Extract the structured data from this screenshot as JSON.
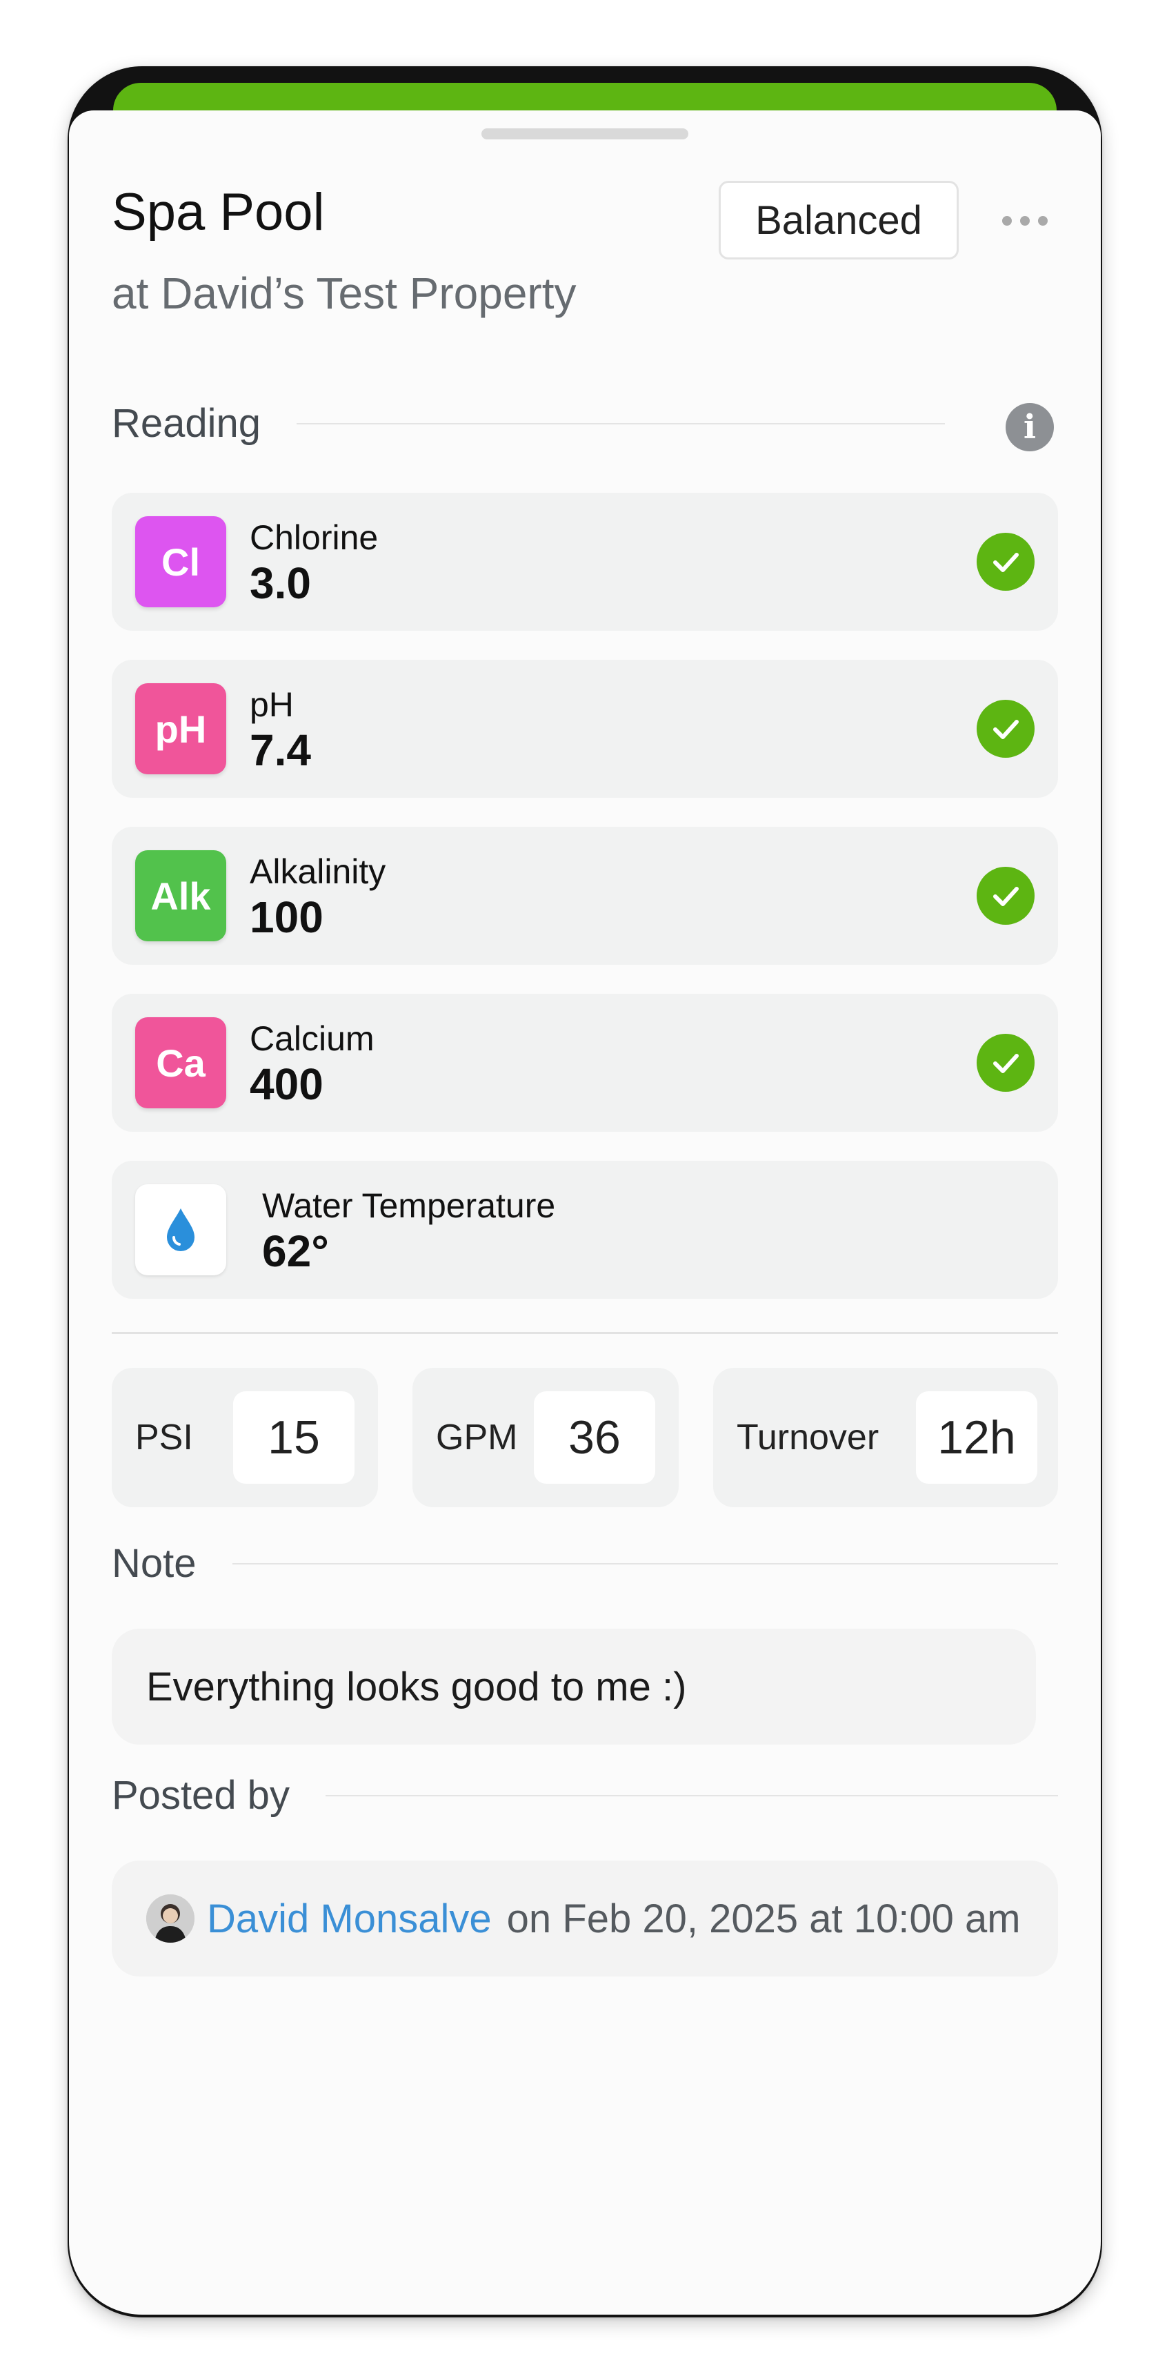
{
  "header": {
    "title": "Spa Pool",
    "subtitle": "at David’s Test Property",
    "status_label": "Balanced"
  },
  "colors": {
    "accent": "#5db512",
    "link": "#3a8fd6"
  },
  "reading": {
    "heading": "Reading",
    "items": [
      {
        "badge": "Cl",
        "label": "Chlorine",
        "value": "3.0",
        "badge_color": "#dd55f0",
        "status_icon": "check-icon"
      },
      {
        "badge": "pH",
        "label": "pH",
        "value": "7.4",
        "badge_color": "#f0559a",
        "status_icon": "check-icon"
      },
      {
        "badge": "Alk",
        "label": "Alkalinity",
        "value": "100",
        "badge_color": "#52c24c",
        "status_icon": "check-icon"
      },
      {
        "badge": "Ca",
        "label": "Calcium",
        "value": "400",
        "badge_color": "#f0559a",
        "status_icon": "check-icon"
      }
    ],
    "temperature": {
      "label": "Water Temperature",
      "value": "62°",
      "icon": "water-drop-icon"
    }
  },
  "metrics": [
    {
      "label": "PSI",
      "value": "15"
    },
    {
      "label": "GPM",
      "value": "36"
    },
    {
      "label": "Turnover",
      "value": "12h"
    }
  ],
  "note": {
    "heading": "Note",
    "text": "Everything looks good to me :)"
  },
  "posted": {
    "heading": "Posted by",
    "name": "David Monsalve",
    "date": "on Feb 20, 2025 at 10:00 am"
  }
}
